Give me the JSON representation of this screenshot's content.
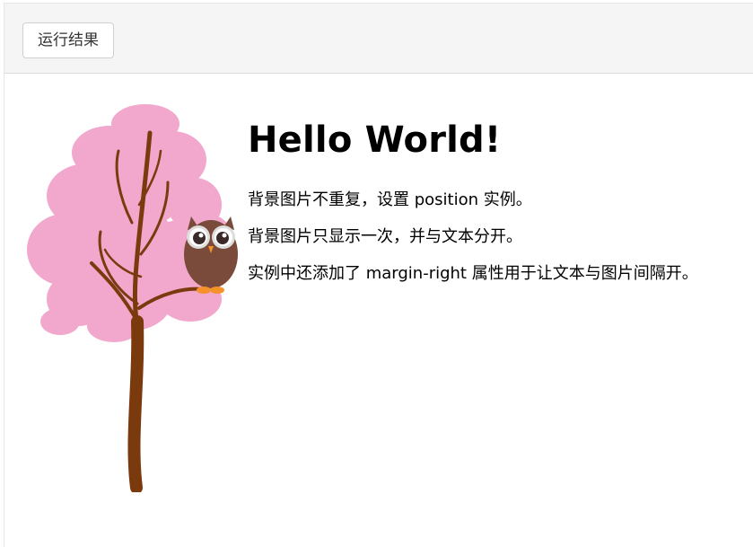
{
  "toolbar": {
    "run_button_label": "运行结果"
  },
  "result": {
    "heading": "Hello World!",
    "paragraphs": [
      "背景图片不重复，设置 position 实例。",
      "背景图片只显示一次，并与文本分开。",
      "实例中还添加了 margin-right 属性用于让文本与图片间隔开。"
    ]
  },
  "colors": {
    "blossom": "#f2a7cc",
    "trunk": "#7a3a0e",
    "owl_body": "#7a4a3a",
    "owl_feet": "#f5922b",
    "toolbar_bg": "#f5f5f5"
  },
  "icons": {
    "tree_image": "tree-with-owl-illustration"
  }
}
